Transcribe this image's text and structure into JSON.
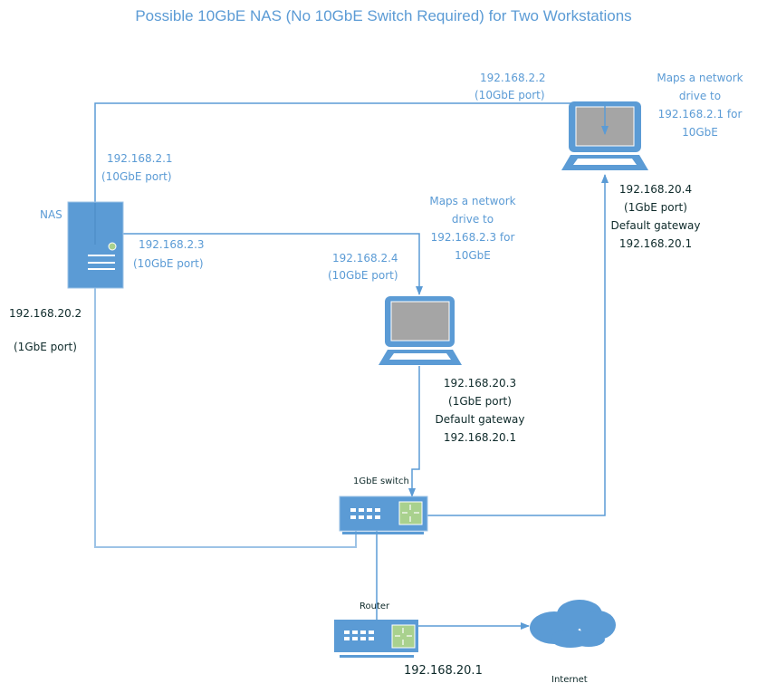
{
  "title": "Possible 10GbE NAS (No 10GbE Switch Required) for Two Workstations",
  "colors": {
    "device_blue": "#5b9bd5",
    "line_blue": "#9dc3e6",
    "screen_gray": "#a5a5a5",
    "led_green": "#a9d18e",
    "text_blue": "#5b9bd5",
    "text_dark": "#0e2a2a"
  },
  "nodes": {
    "nas": {
      "label": "NAS",
      "port_a": {
        "ip": "192.168.2.1",
        "port": "(10GbE port)"
      },
      "port_b": {
        "ip": "192.168.2.3",
        "port": "(10GbE port)"
      },
      "port_1g": {
        "ip": "192.168.20.2",
        "port": "(1GbE port)"
      }
    },
    "workstation_1": {
      "port_10g": {
        "ip": "192.168.2.2",
        "port": "(10GbE port)"
      },
      "note": [
        "Maps a network",
        "drive to",
        "192.168.2.1 for",
        "10GbE"
      ],
      "port_1g": {
        "ip": "192.168.20.4",
        "port": "(1GbE port)",
        "gateway_label": "Default gateway",
        "gateway": "192.168.20.1"
      }
    },
    "workstation_2": {
      "port_10g": {
        "ip": "192.168.2.4",
        "port": "(10GbE port)"
      },
      "note": [
        "Maps a network",
        "drive to",
        "192.168.2.3 for",
        "10GbE"
      ],
      "port_1g": {
        "ip": "192.168.20.3",
        "port": "(1GbE port)",
        "gateway_label": "Default gateway",
        "gateway": "192.168.20.1"
      }
    },
    "switch": {
      "label": "1GbE switch"
    },
    "router": {
      "label": "Router",
      "ip": "192.168.20.1"
    },
    "internet": {
      "label": "Internet"
    }
  }
}
